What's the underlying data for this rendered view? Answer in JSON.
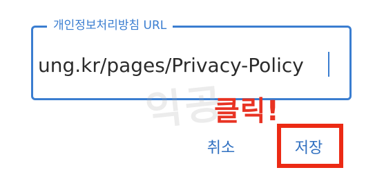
{
  "dialog": {
    "field_label": "개인정보처리방침 URL",
    "field_value": "ung.kr/pages/Privacy-Policy",
    "cancel_label": "취소",
    "save_label": "저장"
  },
  "overlay": {
    "annotation_text": "클릭!",
    "watermark_text": "익공"
  },
  "colors": {
    "accent": "#3a7dd0",
    "button_text": "#2f6fc0",
    "annotation": "#e83323",
    "highlight_box": "#ec2a14"
  }
}
